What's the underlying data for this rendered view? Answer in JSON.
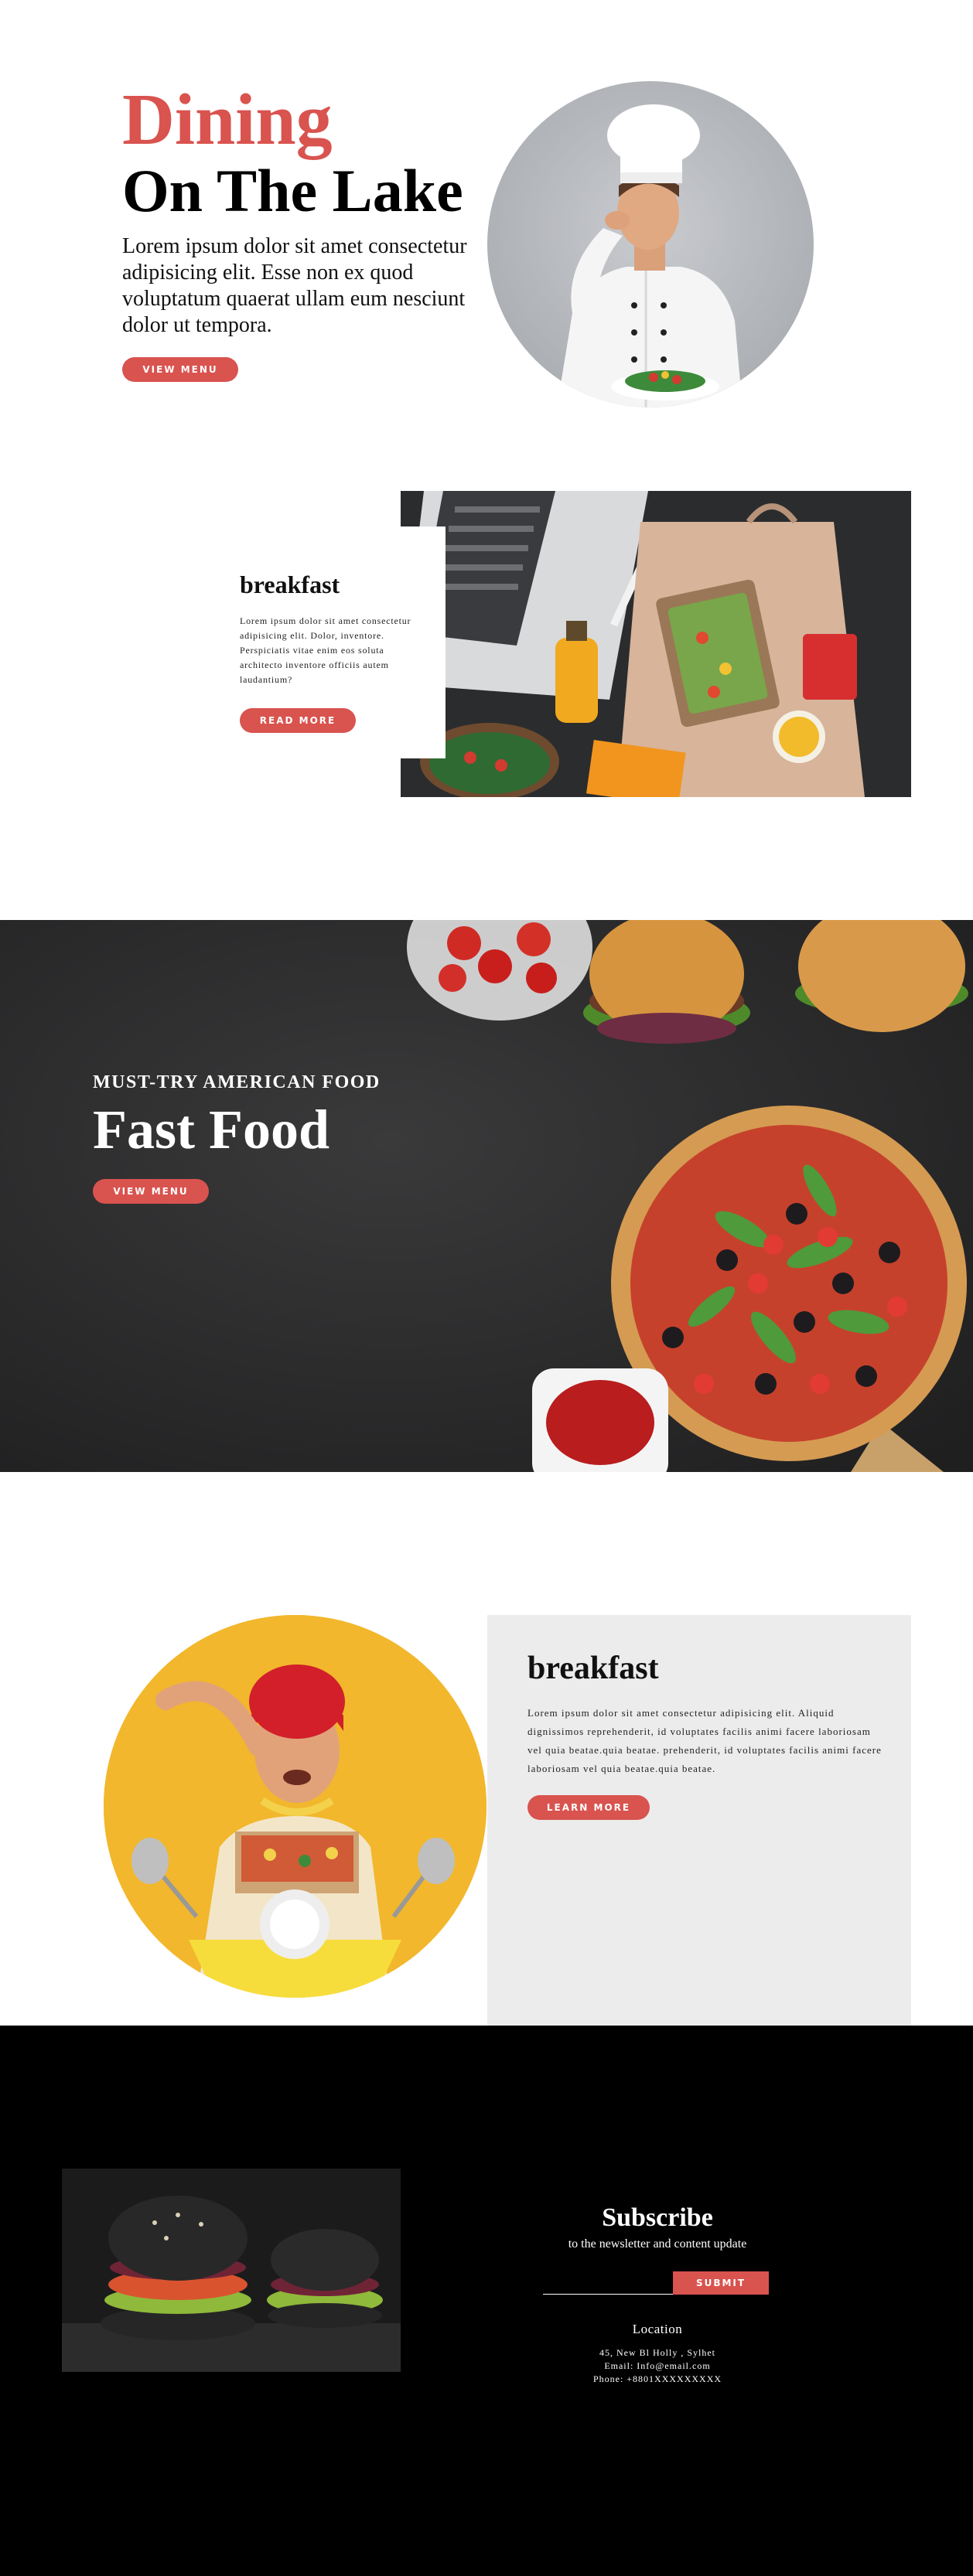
{
  "hero": {
    "accent_title": "Dining",
    "title": "On The Lake",
    "description": "Lorem ipsum dolor sit amet consectetur adipisicing elit. Esse non ex quod voluptatum quaerat ullam eum nesciunt dolor ut tempora.",
    "button": "VIEW MENU"
  },
  "breakfast_1": {
    "title": "breakfast",
    "description": "Lorem ipsum dolor sit amet consectetur adipisicing elit. Dolor, inventore. Perspiciatis vitae enim eos soluta architecto inventore officiis autem laudantium?",
    "button": "READ MORE"
  },
  "fast_food": {
    "kicker": "MUST-TRY AMERICAN FOOD",
    "title": "Fast Food",
    "button": "VIEW MENU"
  },
  "breakfast_2": {
    "title": "breakfast",
    "description": "Lorem ipsum dolor sit amet consectetur adipisicing elit. Aliquid dignissimos reprehenderit, id voluptates facilis animi facere laboriosam vel quia beatae.quia beatae. prehenderit, id voluptates facilis animi facere laboriosam vel quia beatae.quia beatae.",
    "button": "LEARN MORE"
  },
  "footer": {
    "subscribe_title": "Subscribe",
    "subscribe_text": "to the newsletter and content update",
    "email_value": "",
    "submit_button": "SUBMIT",
    "location_title": "Location",
    "location_lines": [
      "45, New Bl Holly , Sylhet",
      "Email: Info@email.com",
      "Phone: +8801XXXXXXXXX"
    ]
  },
  "colors": {
    "accent": "#d9534f",
    "dark_section": "#2a2a2b",
    "panel_gray": "#ececec",
    "footer_bg": "#000000"
  }
}
